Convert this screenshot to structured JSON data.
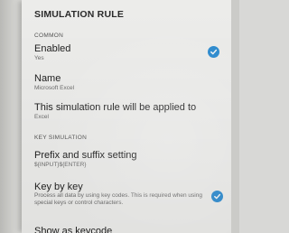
{
  "header": {
    "title": "SIMULATION RULE"
  },
  "sections": {
    "common": "COMMON",
    "key_simulation": "KEY SIMULATION"
  },
  "settings": {
    "enabled": {
      "title": "Enabled",
      "subtitle": "Yes",
      "checked": true
    },
    "name": {
      "title": "Name",
      "subtitle": "Microsoft Excel"
    },
    "applied_to": {
      "title": "This simulation rule will be applied to",
      "subtitle": "Excel"
    },
    "prefix_suffix": {
      "title": "Prefix and suffix setting",
      "subtitle": "${INPUT}${ENTER}"
    },
    "key_by_key": {
      "title": "Key by key",
      "subtitle": "Process all data by using key codes. This is required when using special keys or control characters.",
      "checked": true
    },
    "partial_next": {
      "title": "Show as keycode"
    }
  },
  "colors": {
    "accent": "#2d8fd6",
    "background": "#f4f4f2"
  },
  "icons": {
    "checkbox": "checkmark-icon"
  }
}
